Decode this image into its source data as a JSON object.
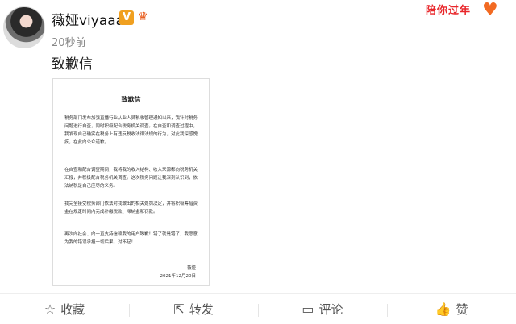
{
  "header": {
    "username": "薇娅viyaaa",
    "v_badge": "V",
    "time": "20秒前",
    "corner_banner": "陪你过年"
  },
  "post": {
    "text": "致歉信"
  },
  "letter": {
    "title": "致歉信",
    "paragraphs": [
      "税务部门发布加强直播行业从业人员税收管理通知以来，我针对税务问题进行自查，同时积极配合税务机关调查。在自查和调查过程中，我发现自己确实在税务上有违反税收法律法规的行为，对此我深感愧疚，在此向公众道歉。",
      "在自查和配合调查期间，我将我的收入结构、收入来源都向税务机关汇报，并积极配合税务机关调查。这次税务问题让我深刻认识到，依法纳税是自己应尽的义务。",
      "我完全接受税务部门依法对我做出的相关处罚决定，并将积极筹措资金在规定时间内完成补缴税款、滞纳金和罚款。",
      "再次向社会、向一直支持信赖我的用户致歉！错了就是错了，我愿意为我的错误承担一切后果，对不起！"
    ],
    "signature": "薇娅",
    "date": "2021年12月20日"
  },
  "footer": {
    "favorite": "收藏",
    "repost": "转发",
    "comment": "评论",
    "like": "赞"
  },
  "colors": {
    "v_badge": "#f0a020",
    "banner_text": "#e8262a"
  }
}
